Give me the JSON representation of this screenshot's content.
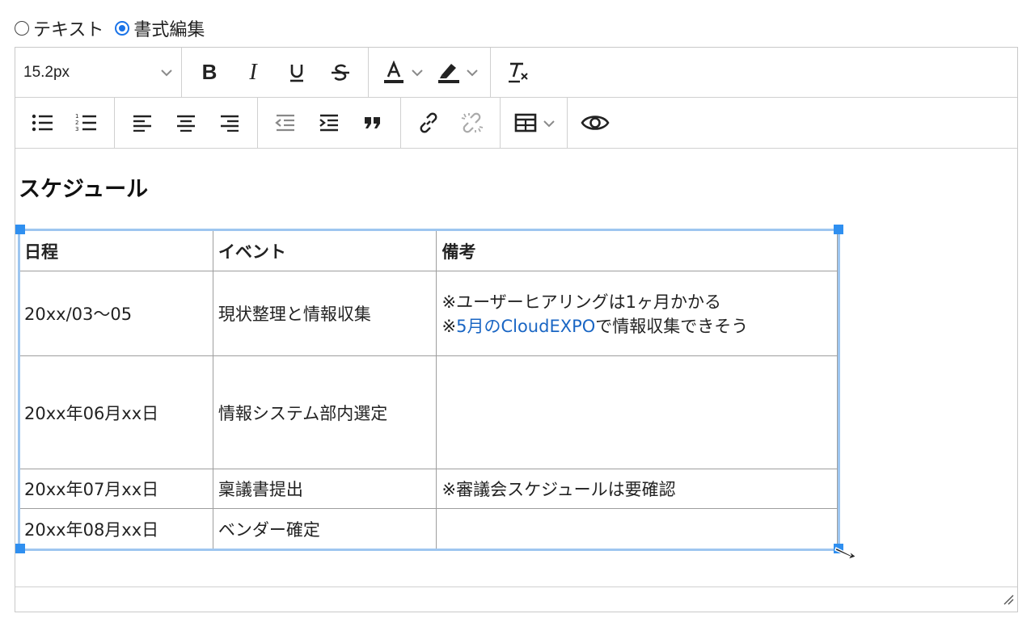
{
  "mode": {
    "text_label": "テキスト",
    "rich_label": "書式編集",
    "selected": "rich"
  },
  "toolbar": {
    "font_size": "15.2px",
    "row1": {
      "bold_icon": "bold-icon",
      "italic_icon": "italic-icon",
      "underline_icon": "underline-icon",
      "strikethrough_icon": "strikethrough-icon",
      "text_color_icon": "text-color-icon",
      "highlight_icon": "highlight-icon",
      "clear_format_icon": "clear-format-icon"
    },
    "row2": {
      "bullet_list_icon": "bullet-list-icon",
      "numbered_list_icon": "numbered-list-icon",
      "align_left_icon": "align-left-icon",
      "align_center_icon": "align-center-icon",
      "align_right_icon": "align-right-icon",
      "outdent_icon": "outdent-icon",
      "indent_icon": "indent-icon",
      "quote_icon": "quote-icon",
      "link_icon": "link-icon",
      "unlink_icon": "unlink-icon",
      "table_icon": "table-icon",
      "preview_icon": "eye-icon"
    }
  },
  "content": {
    "heading": "スケジュール",
    "table": {
      "headers": [
        "日程",
        "イベント",
        "備考"
      ],
      "rows": [
        {
          "date": "20xx/03〜05",
          "event": "現状整理と情報収集",
          "note_line1": "※ユーザーヒアリングは1ヶ月かかる",
          "note_line2_prefix": "※",
          "note_line2_link": "5月のCloudEXPO",
          "note_line2_suffix": "で情報収集できそう"
        },
        {
          "date": "20xx年06月xx日",
          "event": "情報システム部内選定",
          "note": ""
        },
        {
          "date": "20xx年07月xx日",
          "event": "稟議書提出",
          "note": "※審議会スケジュールは要確認"
        },
        {
          "date": "20xx年08月xx日",
          "event": "ベンダー確定",
          "note": ""
        }
      ]
    }
  },
  "colors": {
    "accent": "#2f8ff0",
    "link": "#1a66c4",
    "warning": "#e8231f",
    "selection_border": "#9ec6f0"
  }
}
